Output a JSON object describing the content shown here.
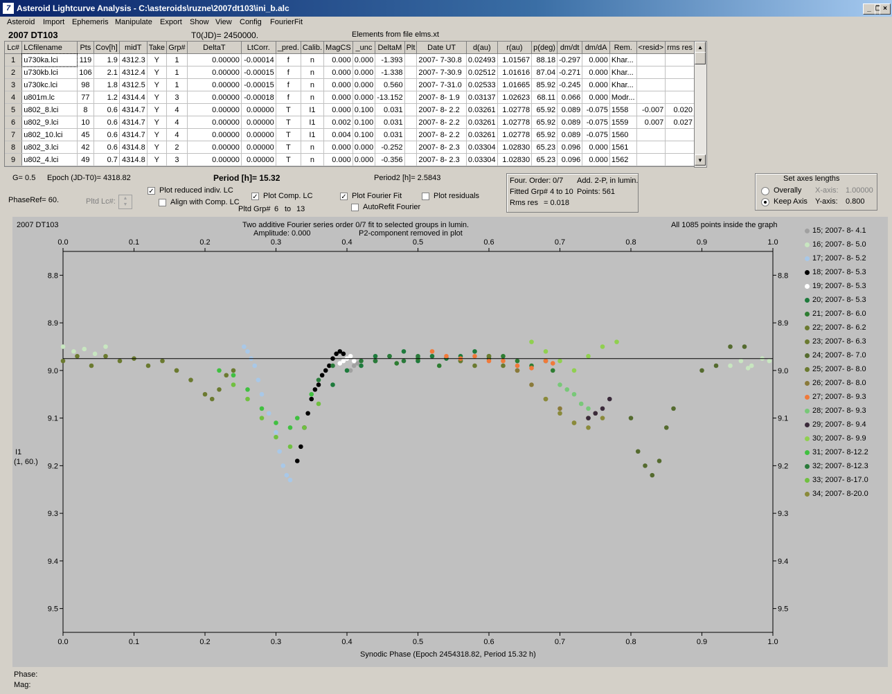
{
  "window": {
    "title": "Asteroid Lightcurve Analysis - C:\\asteroids\\ruzne\\2007dt103\\ini_b.alc",
    "icon_glyph": "7"
  },
  "menu": [
    "Asteroid",
    "Import",
    "Ephemeris",
    "Manipulate",
    "Export",
    "Show",
    "View",
    "Config",
    "FourierFit"
  ],
  "header": {
    "object": "2007 DT103",
    "t0": "T0(JD)= 2450000.",
    "elements": "Elements from file elms.xt"
  },
  "table": {
    "columns": [
      "Lc#",
      "LCfilename",
      "Pts",
      "Cov[h]",
      "midT",
      "Take",
      "Grp#",
      "DeltaT",
      "LtCorr.",
      "_pred.",
      "Calib.",
      "MagCS",
      "_unc",
      "DeltaM",
      "Plt",
      "Date UT",
      "d(au)",
      "r(au)",
      "p(deg)",
      "dm/dt",
      "dm/dA",
      "Rem.",
      "<resid>",
      "rms res"
    ],
    "rows": [
      [
        "1",
        "u730ka.lci",
        "119",
        "1.9",
        "4312.3",
        "Y",
        "1",
        "0.00000",
        "-0.00014",
        "f",
        "n",
        "0.000",
        "0.000",
        "-1.393",
        "",
        "2007- 7-30.8",
        "0.02493",
        "1.01567",
        "88.18",
        "-0.297",
        "0.000",
        "Khar...",
        "",
        ""
      ],
      [
        "2",
        "u730kb.lci",
        "106",
        "2.1",
        "4312.4",
        "Y",
        "1",
        "0.00000",
        "-0.00015",
        "f",
        "n",
        "0.000",
        "0.000",
        "-1.338",
        "",
        "2007- 7-30.9",
        "0.02512",
        "1.01616",
        "87.04",
        "-0.271",
        "0.000",
        "Khar...",
        "",
        ""
      ],
      [
        "3",
        "u730kc.lci",
        "98",
        "1.8",
        "4312.5",
        "Y",
        "1",
        "0.00000",
        "-0.00015",
        "f",
        "n",
        "0.000",
        "0.000",
        "0.560",
        "",
        "2007- 7-31.0",
        "0.02533",
        "1.01665",
        "85.92",
        "-0.245",
        "0.000",
        "Khar...",
        "",
        ""
      ],
      [
        "4",
        "u801m.lc",
        "77",
        "1.2",
        "4314.4",
        "Y",
        "3",
        "0.00000",
        "-0.00018",
        "f",
        "n",
        "0.000",
        "0.000",
        "-13.152",
        "",
        "2007- 8- 1.9",
        "0.03137",
        "1.02623",
        "68.11",
        "0.066",
        "0.000",
        "Modr...",
        "",
        ""
      ],
      [
        "5",
        "u802_8.lci",
        "8",
        "0.6",
        "4314.7",
        "Y",
        "4",
        "0.00000",
        "0.00000",
        "T",
        "I1",
        "0.000",
        "0.100",
        "0.031",
        "",
        "2007- 8- 2.2",
        "0.03261",
        "1.02778",
        "65.92",
        "0.089",
        "-0.075",
        "1558",
        "-0.007",
        "0.020"
      ],
      [
        "6",
        "u802_9.lci",
        "10",
        "0.6",
        "4314.7",
        "Y",
        "4",
        "0.00000",
        "0.00000",
        "T",
        "I1",
        "0.002",
        "0.100",
        "0.031",
        "",
        "2007- 8- 2.2",
        "0.03261",
        "1.02778",
        "65.92",
        "0.089",
        "-0.075",
        "1559",
        "0.007",
        "0.027"
      ],
      [
        "7",
        "u802_10.lci",
        "45",
        "0.6",
        "4314.7",
        "Y",
        "4",
        "0.00000",
        "0.00000",
        "T",
        "I1",
        "0.004",
        "0.100",
        "0.031",
        "",
        "2007- 8- 2.2",
        "0.03261",
        "1.02778",
        "65.92",
        "0.089",
        "-0.075",
        "1560",
        "",
        ""
      ],
      [
        "8",
        "u802_3.lci",
        "42",
        "0.6",
        "4314.8",
        "Y",
        "2",
        "0.00000",
        "0.00000",
        "T",
        "n",
        "0.000",
        "0.000",
        "-0.252",
        "",
        "2007- 8- 2.3",
        "0.03304",
        "1.02830",
        "65.23",
        "0.096",
        "0.000",
        "1561",
        "",
        ""
      ],
      [
        "9",
        "u802_4.lci",
        "49",
        "0.7",
        "4314.8",
        "Y",
        "3",
        "0.00000",
        "0.00000",
        "T",
        "n",
        "0.000",
        "0.000",
        "-0.356",
        "",
        "2007- 8- 2.3",
        "0.03304",
        "1.02830",
        "65.23",
        "0.096",
        "0.000",
        "1562",
        "",
        ""
      ]
    ]
  },
  "params": {
    "g": "G= 0.5",
    "epoch": "Epoch (JD-T0)= 4318.82",
    "period": "Period [h]= 15.32",
    "period2": "Period2 [h]= 2.5843",
    "phaseref": "PhaseRef= 60.",
    "pltd_lc": "Pltd Lc#:",
    "pltd_grp": "Pltd Grp#",
    "grp_from": "6",
    "grp_to_label": "to",
    "grp_to": "13"
  },
  "checks": {
    "plot_reduced": {
      "label": "Plot reduced indiv. LC",
      "checked": true
    },
    "align_comp": {
      "label": "Align with Comp. LC",
      "checked": false
    },
    "plot_comp": {
      "label": "Plot Comp. LC",
      "checked": true
    },
    "plot_fourier": {
      "label": "Plot Fourier Fit",
      "checked": true
    },
    "plot_residuals": {
      "label": "Plot residuals",
      "checked": false
    },
    "autorefit": {
      "label": "AutoRefit Fourier",
      "checked": false
    }
  },
  "fourier_box": {
    "order_label": "Four. Order:",
    "order": "0/7",
    "add": "Add. 2-P, in lumin.",
    "fitted": "Fitted Grp# 4 to 10",
    "points": "Points: 561",
    "rms": "Rms res",
    "rms_val": "= 0.018"
  },
  "axes_box": {
    "title": "Set axes lengths",
    "overall": "Overally",
    "keep": "Keep Axis",
    "xaxis_label": "X-axis:",
    "xaxis": "1.00000",
    "yaxis_label": "Y-axis:",
    "yaxis": "0.800",
    "selected": "keep"
  },
  "plot": {
    "object": "2007 DT103",
    "subtitle1": "Two additive Fourier series order 0/7 fit to selected groups in lumin.",
    "subtitle2": "Amplitude: 0.000",
    "subtitle3": "P2-component removed in plot",
    "points_inside": "All 1085 points inside the graph",
    "ylabel1": "I1",
    "ylabel2": "(1, 60.)",
    "xlabel": "Synodic Phase (Epoch 2454318.82, Period 15.32 h)",
    "fit_level": 8.975
  },
  "chart_data": {
    "type": "scatter",
    "xlabel": "Synodic Phase (Epoch 2454318.82, Period 15.32 h)",
    "ylabel": "I1",
    "xlim": [
      0.0,
      1.0
    ],
    "ylim": [
      8.75,
      9.55
    ],
    "y_inverted": true,
    "xticks": [
      "0.0",
      "0.1",
      "0.2",
      "0.3",
      "0.4",
      "0.5",
      "0.6",
      "0.7",
      "0.8",
      "0.9",
      "1.0"
    ],
    "yticks": [
      "8.8",
      "8.9",
      "9.0",
      "9.1",
      "9.2",
      "9.3",
      "9.4",
      "9.5"
    ],
    "fit_line": {
      "y": 8.975
    },
    "series": [
      {
        "name": "15; 2007- 8- 4.1",
        "color": "#a0a0a0",
        "x": [
          0.41,
          0.405,
          0.415
        ],
        "y": [
          8.99,
          9.0,
          8.985
        ]
      },
      {
        "name": "16; 2007- 8- 5.0",
        "color": "#c8e6c0",
        "x": [
          0.94,
          0.955,
          0.97,
          0.985,
          0.995,
          0.0,
          0.015,
          0.03,
          0.045,
          0.06,
          0.965
        ],
        "y": [
          8.99,
          8.98,
          8.99,
          8.975,
          8.98,
          8.95,
          8.96,
          8.955,
          8.965,
          8.95,
          8.995
        ]
      },
      {
        "name": "17; 2007- 8- 5.2",
        "color": "#a8c8e8",
        "x": [
          0.255,
          0.26,
          0.265,
          0.27,
          0.275,
          0.28,
          0.29,
          0.3,
          0.305,
          0.31,
          0.315,
          0.32
        ],
        "y": [
          8.95,
          8.96,
          8.975,
          8.99,
          9.02,
          9.05,
          9.09,
          9.13,
          9.17,
          9.2,
          9.22,
          9.23
        ]
      },
      {
        "name": "18; 2007- 8- 5.3",
        "color": "#000000",
        "x": [
          0.33,
          0.335,
          0.34,
          0.345,
          0.35,
          0.355,
          0.36,
          0.365,
          0.37,
          0.375,
          0.38,
          0.385,
          0.39,
          0.395
        ],
        "y": [
          9.19,
          9.16,
          9.12,
          9.09,
          9.06,
          9.04,
          9.03,
          9.01,
          9.0,
          8.99,
          8.975,
          8.965,
          8.96,
          8.965
        ]
      },
      {
        "name": "19; 2007- 8- 5.3",
        "color": "#ffffff",
        "x": [
          0.39,
          0.395,
          0.4,
          0.405,
          0.41
        ],
        "y": [
          8.985,
          8.98,
          8.975,
          8.97,
          8.98
        ]
      },
      {
        "name": "20; 2007- 8- 5.3",
        "color": "#1e7a3c",
        "x": [
          0.38,
          0.4,
          0.42,
          0.44,
          0.46,
          0.48,
          0.5,
          0.52,
          0.54,
          0.56,
          0.58,
          0.6
        ],
        "y": [
          9.03,
          9.0,
          8.99,
          8.97,
          8.97,
          8.96,
          8.98,
          8.97,
          8.975,
          8.97,
          8.96,
          8.97
        ]
      },
      {
        "name": "21; 2007- 8- 6.0",
        "color": "#2e7d32",
        "x": [
          0.6,
          0.62,
          0.64,
          0.66,
          0.68,
          0.69,
          0.44,
          0.47,
          0.5,
          0.53,
          0.56
        ],
        "y": [
          8.975,
          8.97,
          8.98,
          8.99,
          8.98,
          9.0,
          8.98,
          8.985,
          8.975,
          8.99,
          8.98
        ]
      },
      {
        "name": "22; 2007- 8- 6.2",
        "color": "#6b7a30",
        "x": [
          0.0,
          0.02,
          0.04,
          0.06,
          0.08,
          0.1,
          0.12,
          0.14,
          0.16
        ],
        "y": [
          8.98,
          8.97,
          8.99,
          8.97,
          8.98,
          8.975,
          8.99,
          8.98,
          9.0
        ]
      },
      {
        "name": "23; 2007- 8- 6.3",
        "color": "#6b7a30",
        "x": [
          0.16,
          0.18,
          0.2,
          0.21,
          0.22,
          0.23,
          0.24
        ],
        "y": [
          9.0,
          9.02,
          9.05,
          9.06,
          9.04,
          9.01,
          9.0
        ]
      },
      {
        "name": "24; 2007- 8- 7.0",
        "color": "#556b2f",
        "x": [
          0.8,
          0.81,
          0.82,
          0.83,
          0.84,
          0.85,
          0.86,
          0.9,
          0.92,
          0.94,
          0.96
        ],
        "y": [
          9.1,
          9.17,
          9.2,
          9.22,
          9.19,
          9.12,
          9.08,
          9.0,
          8.99,
          8.95,
          8.95
        ]
      },
      {
        "name": "25; 2007- 8- 8.0",
        "color": "#6b7a30",
        "x": [
          0.56,
          0.58,
          0.6,
          0.62,
          0.64
        ],
        "y": [
          8.98,
          8.99,
          8.97,
          8.99,
          9.0
        ]
      },
      {
        "name": "26; 2007- 8- 8.0",
        "color": "#8a7a3a",
        "x": [
          0.64,
          0.66,
          0.68,
          0.7,
          0.72,
          0.74,
          0.75
        ],
        "y": [
          9.0,
          9.03,
          9.06,
          9.08,
          9.11,
          9.1,
          9.09
        ]
      },
      {
        "name": "27; 2007- 8- 9.3",
        "color": "#f07a3a",
        "x": [
          0.52,
          0.54,
          0.56,
          0.58,
          0.6,
          0.62,
          0.64,
          0.66,
          0.68,
          0.69
        ],
        "y": [
          8.96,
          8.97,
          8.975,
          8.97,
          8.98,
          8.98,
          8.99,
          8.995,
          8.98,
          8.985
        ]
      },
      {
        "name": "28; 2007- 8- 9.3",
        "color": "#78c878",
        "x": [
          0.7,
          0.71,
          0.72,
          0.73,
          0.74
        ],
        "y": [
          9.03,
          9.04,
          9.05,
          9.07,
          9.08
        ]
      },
      {
        "name": "29; 2007- 8- 9.4",
        "color": "#3a2a3a",
        "x": [
          0.74,
          0.75,
          0.76,
          0.77
        ],
        "y": [
          9.1,
          9.09,
          9.08,
          9.06
        ]
      },
      {
        "name": "30; 2007- 8- 9.9",
        "color": "#90d050",
        "x": [
          0.66,
          0.68,
          0.7,
          0.72,
          0.74,
          0.76,
          0.78
        ],
        "y": [
          8.94,
          8.96,
          8.98,
          9.0,
          8.97,
          8.95,
          8.94
        ]
      },
      {
        "name": "31; 2007- 8-12.2",
        "color": "#40c040",
        "x": [
          0.22,
          0.24,
          0.26,
          0.28,
          0.3,
          0.32,
          0.33,
          0.35
        ],
        "y": [
          9.0,
          9.01,
          9.04,
          9.08,
          9.11,
          9.12,
          9.1,
          9.05
        ]
      },
      {
        "name": "32; 2007- 8-12.3",
        "color": "#2a7a3a",
        "x": [
          0.36,
          0.38,
          0.42,
          0.44,
          0.46,
          0.48,
          0.5
        ],
        "y": [
          9.02,
          8.99,
          8.98,
          8.98,
          8.97,
          8.98,
          8.97
        ]
      },
      {
        "name": "33; 2007- 8-17.0",
        "color": "#70c040",
        "x": [
          0.24,
          0.26,
          0.28,
          0.3,
          0.32,
          0.34,
          0.36
        ],
        "y": [
          9.03,
          9.06,
          9.1,
          9.14,
          9.16,
          9.12,
          9.07
        ]
      },
      {
        "name": "34; 2007- 8-20.0",
        "color": "#8a8a3a",
        "x": [
          0.68,
          0.7,
          0.72,
          0.74,
          0.76
        ],
        "y": [
          9.06,
          9.09,
          9.11,
          9.12,
          9.1
        ]
      }
    ]
  },
  "status": {
    "phase_label": "Phase:",
    "mag_label": "Mag:"
  }
}
